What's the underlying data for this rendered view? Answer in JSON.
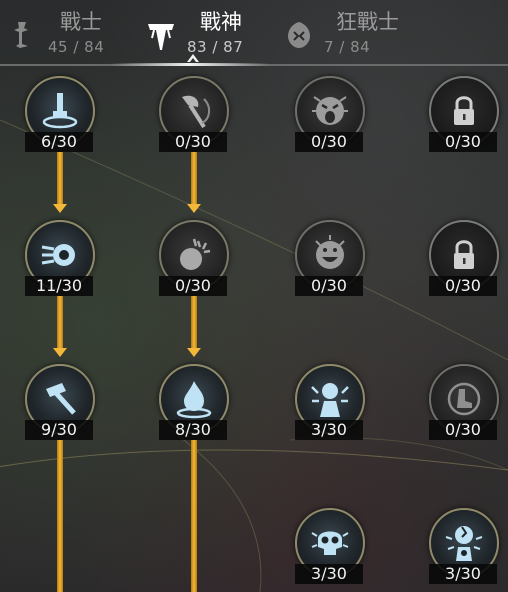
{
  "tabs": [
    {
      "name": "戰士",
      "points": "45 / 84",
      "icon": "warrior-class-icon",
      "active": false
    },
    {
      "name": "戰神",
      "points": "83 / 87",
      "icon": "warlord-class-icon",
      "active": true
    },
    {
      "name": "狂戰士",
      "points": "7 / 84",
      "icon": "berserker-class-icon",
      "active": false
    }
  ],
  "skills": {
    "col1": [
      {
        "level": "6/30",
        "icon": "ground-spike-icon"
      },
      {
        "level": "11/30",
        "icon": "whirl-shield-icon"
      },
      {
        "level": "9/30",
        "icon": "hammer-strike-icon"
      }
    ],
    "col2": [
      {
        "level": "0/30",
        "icon": "axe-throw-icon"
      },
      {
        "level": "0/30",
        "icon": "bomb-blast-icon"
      },
      {
        "level": "8/30",
        "icon": "flame-burst-icon"
      }
    ],
    "col3": [
      {
        "level": "0/30",
        "icon": "roaring-face-icon"
      },
      {
        "level": "0/30",
        "icon": "grinning-face-icon"
      },
      {
        "level": "3/30",
        "icon": "shouting-figure-icon"
      },
      {
        "level": "3/30",
        "icon": "skull-icon"
      }
    ],
    "col4": [
      {
        "level": "0/30",
        "icon": "locked-skill-icon"
      },
      {
        "level": "0/30",
        "icon": "locked-skill-icon"
      },
      {
        "level": "0/30",
        "icon": "boot-swirl-icon"
      },
      {
        "level": "3/30",
        "icon": "cracked-figure-icon"
      }
    ]
  },
  "colors": {
    "connector": "#f3b739",
    "ring": "#8e8a6a",
    "icon": "#bfe3f5"
  }
}
